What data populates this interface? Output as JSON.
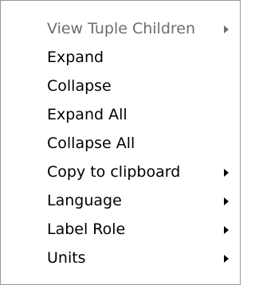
{
  "context_menu": {
    "items": [
      {
        "label": "View Tuple Children",
        "disabled": true,
        "submenu": true
      },
      {
        "label": "Expand",
        "disabled": false,
        "submenu": false
      },
      {
        "label": "Collapse",
        "disabled": false,
        "submenu": false
      },
      {
        "label": "Expand All",
        "disabled": false,
        "submenu": false
      },
      {
        "label": "Collapse All",
        "disabled": false,
        "submenu": false
      },
      {
        "label": "Copy to clipboard",
        "disabled": false,
        "submenu": true
      },
      {
        "label": "Language",
        "disabled": false,
        "submenu": true
      },
      {
        "label": "Label Role",
        "disabled": false,
        "submenu": true
      },
      {
        "label": "Units",
        "disabled": false,
        "submenu": true
      }
    ],
    "colors": {
      "background": "#ffffff",
      "border": "#979797",
      "text": "#000000",
      "disabled_text": "#6d6d6d"
    }
  }
}
